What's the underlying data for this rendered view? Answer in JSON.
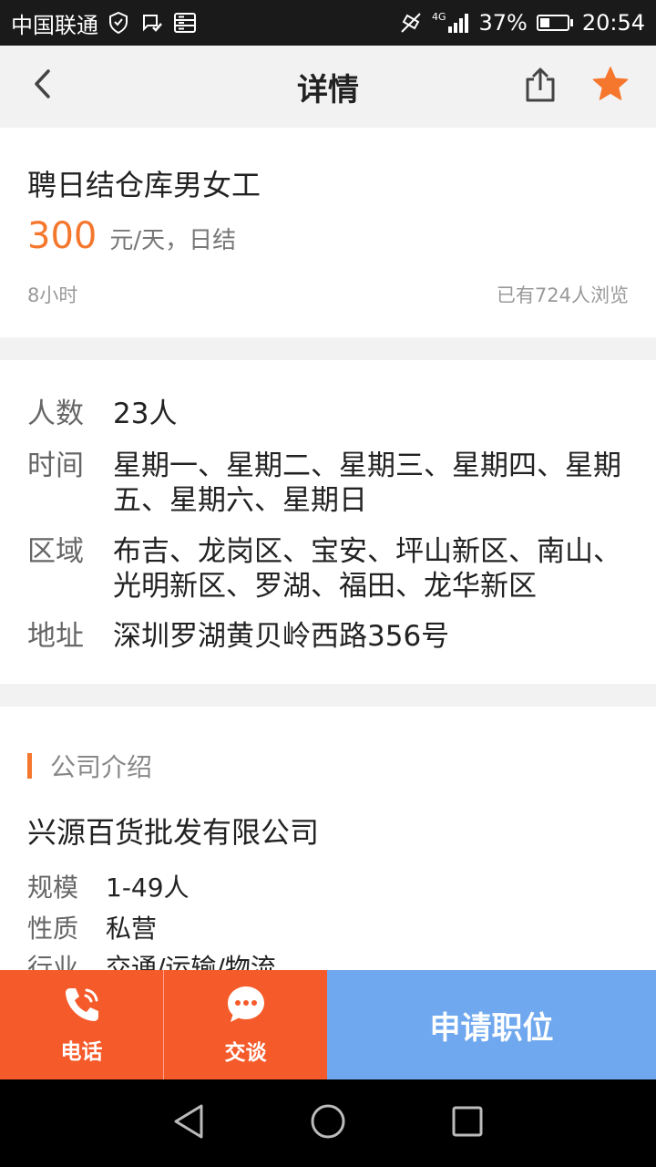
{
  "status_bar": {
    "carrier": "中国联通",
    "network": "4G",
    "battery_percent": "37%",
    "battery_level": 0.37,
    "time": "20:54"
  },
  "header": {
    "title": "详情"
  },
  "job": {
    "title": "聘日结仓库男女工",
    "salary_amount": "300",
    "salary_unit": "元/天，日结",
    "hours": "8小时",
    "views": "已有724人浏览"
  },
  "details": [
    {
      "label": "人数",
      "value": "23人"
    },
    {
      "label": "时间",
      "value": "星期一、星期二、星期三、星期四、星期五、星期六、星期日"
    },
    {
      "label": "区域",
      "value": "布吉、龙岗区、宝安、坪山新区、南山、光明新区、罗湖、福田、龙华新区"
    },
    {
      "label": "地址",
      "value": "深圳罗湖黄贝岭西路356号"
    }
  ],
  "company": {
    "section_title": "公司介绍",
    "name": "兴源百货批发有限公司",
    "rows": [
      {
        "label": "规模",
        "value": "1-49人"
      },
      {
        "label": "性质",
        "value": "私营"
      },
      {
        "label": "行业",
        "value": "交通/运输/物流"
      }
    ]
  },
  "actions": {
    "phone_label": "电话",
    "chat_label": "交谈",
    "apply_label": "申请职位"
  },
  "icons": {
    "back": "chevron-left-icon",
    "share": "share-icon",
    "favorite": "star-icon",
    "phone": "phone-icon",
    "chat": "chat-bubble-icon"
  },
  "colors": {
    "accent": "#f5772d",
    "action_orange": "#f55a2a",
    "apply_blue": "#6fa8ee"
  }
}
